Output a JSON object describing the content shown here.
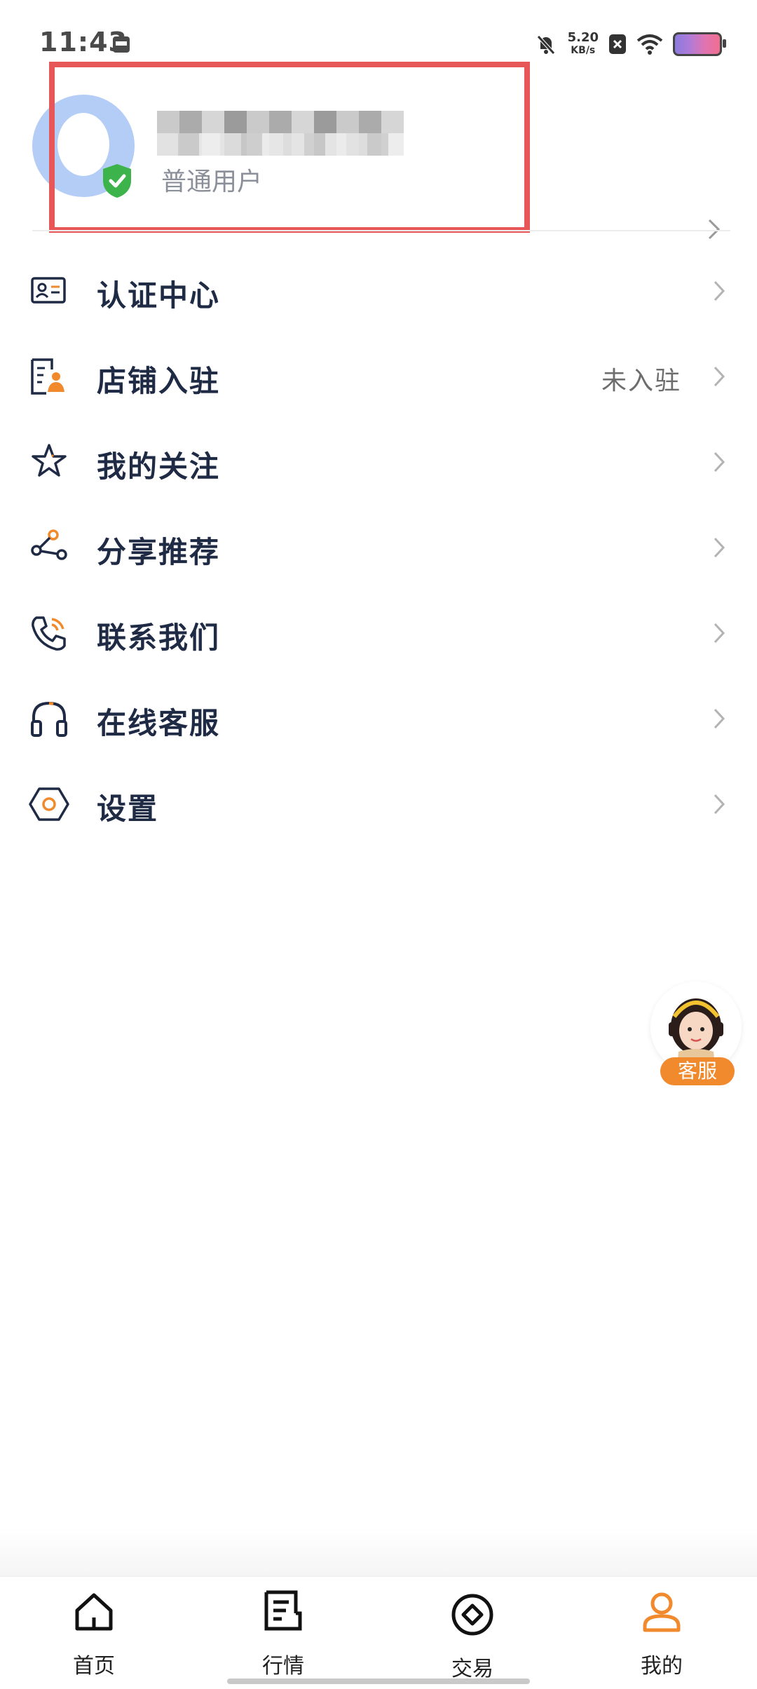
{
  "status_bar": {
    "time": "11:43",
    "net_speed": "5.20",
    "net_unit": "KB/s",
    "icons": [
      "calendar-icon",
      "mute-bell-icon",
      "sim-x-icon",
      "wifi-icon",
      "battery-icon"
    ]
  },
  "profile": {
    "user_level": "普通用户",
    "username_obscured": true
  },
  "menu": {
    "items": [
      {
        "label": "认证中心",
        "icon": "id-card-icon"
      },
      {
        "label": "店铺入驻",
        "icon": "store-document-icon",
        "value": "未入驻"
      },
      {
        "label": "我的关注",
        "icon": "star-icon"
      },
      {
        "label": "分享推荐",
        "icon": "share-icon"
      },
      {
        "label": "联系我们",
        "icon": "phone-icon"
      },
      {
        "label": "在线客服",
        "icon": "headset-icon"
      },
      {
        "label": "设置",
        "icon": "settings-hexagon-icon"
      }
    ]
  },
  "floating_service": {
    "label": "客服"
  },
  "tab_bar": {
    "tabs": [
      {
        "label": "首页",
        "icon": "home-icon"
      },
      {
        "label": "行情",
        "icon": "document-list-icon"
      },
      {
        "label": "交易",
        "icon": "trade-circle-icon"
      },
      {
        "label": "我的",
        "icon": "user-icon",
        "active": true
      }
    ]
  },
  "colors": {
    "accent": "#f08a2c",
    "text_primary": "#1f2a44",
    "highlight_border": "#e85757",
    "verified_green": "#3cb44b"
  }
}
